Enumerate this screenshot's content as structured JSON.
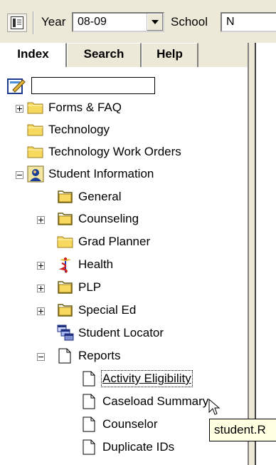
{
  "toolbar": {
    "year_label": "Year",
    "year_value": "08-09",
    "school_label": "School",
    "school_value": "N"
  },
  "tabs": [
    {
      "label": "Index",
      "active": true
    },
    {
      "label": "Search",
      "active": false
    },
    {
      "label": "Help",
      "active": false
    }
  ],
  "search": {
    "value": ""
  },
  "tree": [
    {
      "id": "forms",
      "label": "Forms & FAQ",
      "icon": "folder-icon",
      "expander": "plus"
    },
    {
      "id": "technology",
      "label": "Technology",
      "icon": "folder-icon"
    },
    {
      "id": "tech-work-orders",
      "label": "Technology Work Orders",
      "icon": "folder-icon"
    },
    {
      "id": "student-information",
      "label": "Student Information",
      "icon": "student-icon",
      "expander": "minus"
    },
    {
      "id": "general",
      "label": "General",
      "icon": "open-folder-icon"
    },
    {
      "id": "counseling",
      "label": "Counseling",
      "icon": "open-folder-icon",
      "expander": "plus"
    },
    {
      "id": "grad-planner",
      "label": "Grad Planner",
      "icon": "folder-icon"
    },
    {
      "id": "health",
      "label": "Health",
      "icon": "caduceus-icon",
      "expander": "plus"
    },
    {
      "id": "plp",
      "label": "PLP",
      "icon": "open-folder-icon",
      "expander": "plus"
    },
    {
      "id": "special-ed",
      "label": "Special Ed",
      "icon": "open-folder-icon",
      "expander": "plus"
    },
    {
      "id": "student-locator",
      "label": "Student Locator",
      "icon": "locator-icon"
    },
    {
      "id": "reports",
      "label": "Reports",
      "icon": "document-icon",
      "expander": "minus"
    },
    {
      "id": "activity-eligibility",
      "label": "Activity Eligibility",
      "icon": "document-icon",
      "focused": true
    },
    {
      "id": "caseload-summary",
      "label": "Caseload Summary",
      "icon": "document-icon"
    },
    {
      "id": "counselor",
      "label": "Counselor",
      "icon": "document-icon"
    },
    {
      "id": "duplicate-ids",
      "label": "Duplicate IDs",
      "icon": "document-icon"
    }
  ],
  "tooltip": {
    "text": "student.R"
  },
  "colors": {
    "folder": "#f7d960",
    "folder_edge": "#9c7d1c",
    "panel_bg": "#ffffff",
    "chrome_bg": "#ece9d8"
  }
}
